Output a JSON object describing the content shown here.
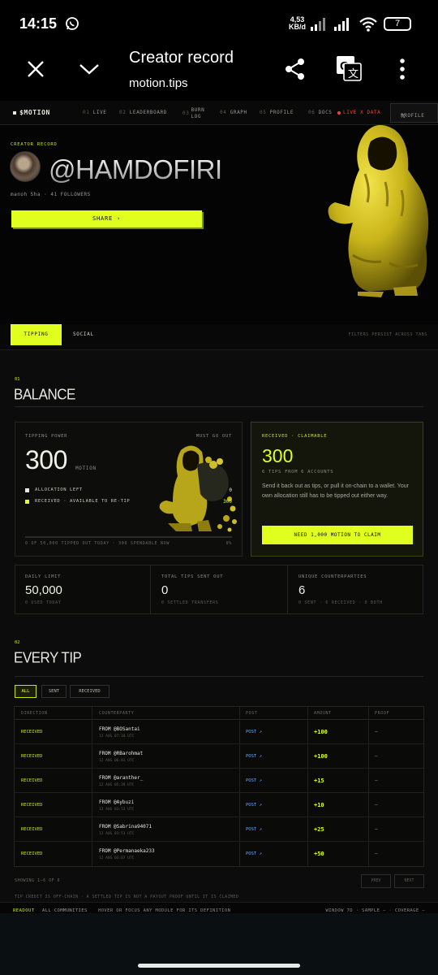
{
  "status_bar": {
    "time": "14:15",
    "net_speed_top": "4,53",
    "net_speed_unit": "KB/d",
    "battery": "7"
  },
  "browser": {
    "title": "Creator record",
    "url": "motion.tips"
  },
  "nav": {
    "brand": "$MOTION",
    "items": [
      {
        "num": "01",
        "label": "LIVE"
      },
      {
        "num": "02",
        "label": "LEADERBOARD"
      },
      {
        "num": "03",
        "label": "BURN LOG"
      },
      {
        "num": "04",
        "label": "GRAPH"
      },
      {
        "num": "05",
        "label": "PROFILE"
      },
      {
        "num": "06",
        "label": "DOCS"
      }
    ],
    "live": "LIVE X DATA",
    "profile_button": "PROFILE"
  },
  "hero": {
    "eyebrow": "CREATOR RECORD",
    "handle": "@HAMDOFIRI",
    "meta": "manoh Sha · 41 FOLLOWERS",
    "share": "SHARE"
  },
  "tabs": {
    "tipping": "TIPPING",
    "social": "SOCIAL",
    "note": "FILTERS PERSIST ACROSS TABS"
  },
  "balance": {
    "num": "01",
    "heading": "BALANCE",
    "power_label": "TIPPING POWER",
    "must_go_out": "MUST GO OUT",
    "power_value": "300",
    "power_unit": "MOTION",
    "legend_allocation": "ALLOCATION LEFT",
    "legend_allocation_value": "0",
    "legend_received": "RECEIVED · AVAILABLE TO RE-TIP",
    "legend_received_value": "300",
    "footer_left": "0 OF 50,000 TIPPED OUT TODAY · 300 SPENDABLE NOW",
    "footer_right": "0%",
    "claim_label": "RECEIVED · CLAIMABLE",
    "claim_value": "300",
    "claim_sub": "6 TIPS FROM 6 ACCOUNTS",
    "claim_text": "Send it back out as tips, or pull it on-chain to a wallet. Your own allocation still has to be tipped out either way.",
    "claim_button": "NEED 1,000 MOTION TO CLAIM"
  },
  "stats": [
    {
      "label": "DAILY LIMIT",
      "value": "50,000",
      "sub": "0 USED TODAY"
    },
    {
      "label": "TOTAL TIPS SENT OUT",
      "value": "0",
      "sub": "0 SETTLED TRANSFERS"
    },
    {
      "label": "UNIQUE COUNTERPARTIES",
      "value": "6",
      "sub": "0 SENT · 6 RECEIVED · 0 BOTH"
    }
  ],
  "tips": {
    "num": "02",
    "heading": "EVERY TIP",
    "filters": [
      "ALL",
      "SENT",
      "RECEIVED"
    ],
    "columns": [
      "DIRECTION",
      "COUNTERPARTY",
      "POST",
      "AMOUNT",
      "PROOF"
    ],
    "rows": [
      {
        "direction": "RECEIVED",
        "from": "FROM @BOSantai",
        "time": "12 AUG 07:10 UTC",
        "post": "POST ↗",
        "amount": "+100",
        "proof": "—"
      },
      {
        "direction": "RECEIVED",
        "from": "FROM @RBarohmat",
        "time": "12 AUG 06:01 UTC",
        "post": "POST ↗",
        "amount": "+100",
        "proof": "—"
      },
      {
        "direction": "RECEIVED",
        "from": "FROM @aranther_",
        "time": "12 AUG 05:39 UTC",
        "post": "POST ↗",
        "amount": "+15",
        "proof": "—"
      },
      {
        "direction": "RECEIVED",
        "from": "FROM @Aybuzi",
        "time": "12 AUG 03:53 UTC",
        "post": "POST ↗",
        "amount": "+10",
        "proof": "—"
      },
      {
        "direction": "RECEIVED",
        "from": "FROM @Sabrina94071",
        "time": "12 AUG 03:53 UTC",
        "post": "POST ↗",
        "amount": "+25",
        "proof": "—"
      },
      {
        "direction": "RECEIVED",
        "from": "FROM @Permanaeka233",
        "time": "12 AUG 03:07 UTC",
        "post": "POST ↗",
        "amount": "+50",
        "proof": "—"
      }
    ],
    "showing": "SHOWING 1–6 OF 6",
    "prev": "PREV",
    "next": "NEXT",
    "disclaimer": "TIP CREDIT IS OFF-CHAIN · A SETTLED TIP IS NOT A PAYOUT PROOF UNTIL IT IS CLAIMED"
  },
  "readout": {
    "label": "READOUT",
    "communities": "ALL COMMUNITIES",
    "hint": "HOVER OR FOCUS ANY MODULE FOR ITS DEFINITION",
    "right": "WINDOW 7D · SAMPLE – · COVERAGE –"
  },
  "colors": {
    "accent": "#e0ff1f",
    "background": "#0b0c0b",
    "live": "#ff3b3b",
    "link": "#6aa8ff"
  }
}
